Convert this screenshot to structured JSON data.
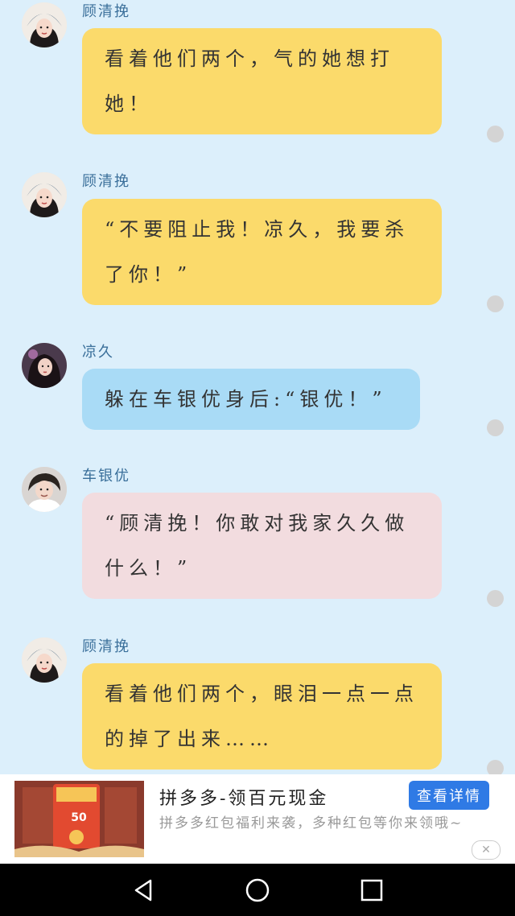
{
  "messages": [
    {
      "speaker": "顾清挽",
      "avatar": "avatar-gu-qingwan",
      "color": "yellow",
      "lines": [
        "看着他们两个，气的她想打",
        "她！"
      ]
    },
    {
      "speaker": "顾清挽",
      "avatar": "avatar-gu-qingwan",
      "color": "yellow",
      "lines": [
        "“不要阻止我！凉久，我要杀",
        "了你！”"
      ]
    },
    {
      "speaker": "凉久",
      "avatar": "avatar-liangjiu",
      "color": "blue",
      "lines": [
        "躲在车银优身后:“银优！”"
      ]
    },
    {
      "speaker": "车银优",
      "avatar": "avatar-che-yinyou",
      "color": "pink",
      "lines": [
        "“顾清挽！你敢对我家久久做",
        "什么！”"
      ]
    },
    {
      "speaker": "顾清挽",
      "avatar": "avatar-gu-qingwan",
      "color": "yellow",
      "lines": [
        "看着他们两个，眼泪一点一点",
        "的掉了出来……"
      ]
    }
  ],
  "ad": {
    "title": "拼多多-领百元现金",
    "description": "拼多多红包福利来袭，多种红包等你来领哦~",
    "button_label": "查看详情",
    "image_amount": "50",
    "close_icon": "close-icon"
  },
  "colors": {
    "background": "#dceffb",
    "yellow_bubble": "#fbda6b",
    "blue_bubble": "#a9dbf6",
    "pink_bubble": "#f2dcdf",
    "ad_button": "#2f7ae5"
  },
  "navbar": {
    "icons": [
      "back-icon",
      "home-icon",
      "recents-icon"
    ]
  }
}
